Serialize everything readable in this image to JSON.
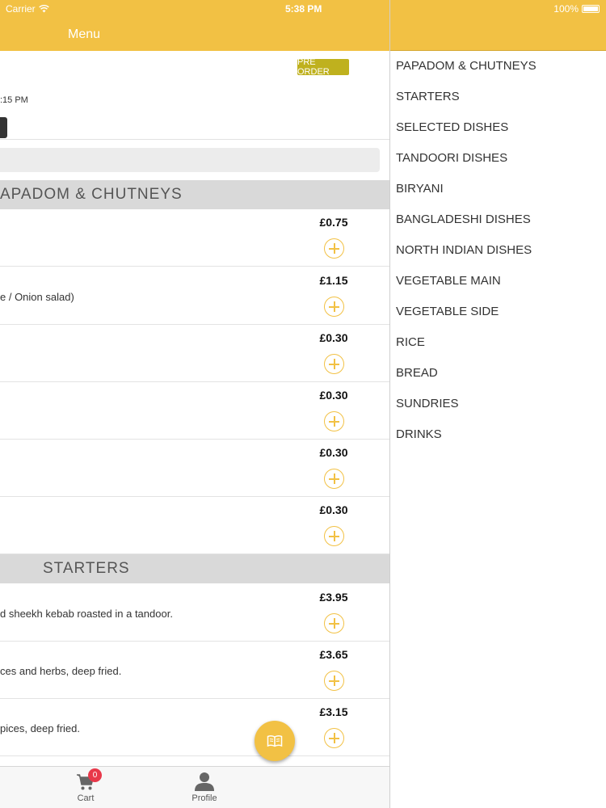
{
  "status_bar": {
    "carrier": "Carrier",
    "time": "5:38 PM",
    "battery": "100%"
  },
  "header": {
    "title": "Menu"
  },
  "main": {
    "preorder_label": "PRE ORDER",
    "time_text": ":15 PM",
    "sections": [
      {
        "title": "APADOM & CHUTNEYS",
        "items": [
          {
            "price": "£0.75",
            "desc": ""
          },
          {
            "price": "£1.15",
            "desc": "e / Onion salad)"
          },
          {
            "price": "£0.30",
            "desc": ""
          },
          {
            "price": "£0.30",
            "desc": ""
          },
          {
            "price": "£0.30",
            "desc": ""
          },
          {
            "price": "£0.30",
            "desc": ""
          }
        ]
      },
      {
        "title": "STARTERS",
        "items": [
          {
            "price": "£3.95",
            "desc": "d sheekh kebab roasted in a tandoor."
          },
          {
            "price": "£3.65",
            "desc": "ces and herbs, deep fried."
          },
          {
            "price": "£3.15",
            "desc": "pices, deep fried."
          }
        ]
      }
    ]
  },
  "tabbar": {
    "cart_label": "Cart",
    "cart_count": "0",
    "profile_label": "Profile"
  },
  "categories": [
    "PAPADOM & CHUTNEYS",
    "STARTERS",
    "SELECTED DISHES",
    "TANDOORI DISHES",
    "BIRYANI",
    "BANGLADESHI DISHES",
    "NORTH INDIAN DISHES",
    "VEGETABLE MAIN",
    "VEGETABLE SIDE",
    "RICE",
    "BREAD",
    "SUNDRIES",
    "DRINKS"
  ],
  "colors": {
    "accent": "#f2c144",
    "preorder": "#bfb11e",
    "badge": "#e8384a"
  }
}
